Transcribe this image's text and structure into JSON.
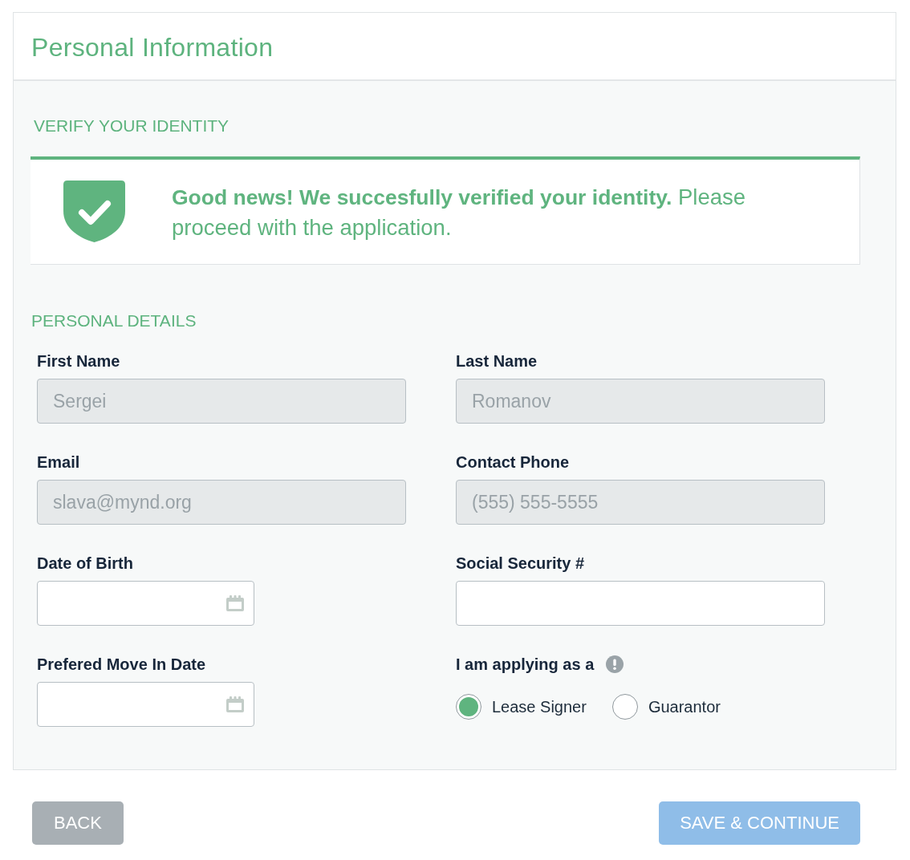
{
  "header": {
    "title": "Personal Information"
  },
  "verification": {
    "heading": "VERIFY YOUR IDENTITY",
    "message": "**Good news! We succesfully verified your identity.** Please proceed with the application."
  },
  "personal_details": {
    "heading": "PERSONAL DETAILS",
    "fields": [
      {
        "label": "First Name",
        "kind": "text",
        "value": "Sergei",
        "disabled": true,
        "info": false
      },
      {
        "label": "Last Name",
        "kind": "text",
        "value": "Romanov",
        "disabled": true,
        "info": false
      },
      {
        "label": "Email",
        "kind": "text",
        "value": "slava@mynd.org",
        "disabled": true,
        "info": false
      },
      {
        "label": "Contact Phone",
        "kind": "text",
        "value": "(555) 555-5555",
        "disabled": true,
        "info": false
      },
      {
        "label": "Date of Birth",
        "kind": "date",
        "disabled": false,
        "info": false
      },
      {
        "label": "Social Security #",
        "kind": "text",
        "disabled": false,
        "info": false
      },
      {
        "label": "Prefered Move In Date",
        "kind": "date",
        "disabled": false,
        "info": false
      },
      {
        "label": "I am applying as a",
        "kind": "radio",
        "info": true,
        "options": [
          {
            "label": "Lease Signer",
            "selected": true
          },
          {
            "label": "Guarantor",
            "selected": false
          }
        ]
      }
    ]
  },
  "buttons": [
    {
      "label": "BACK",
      "kind": "secondary"
    },
    {
      "label": "SAVE & CONTINUE",
      "kind": "primary"
    }
  ]
}
